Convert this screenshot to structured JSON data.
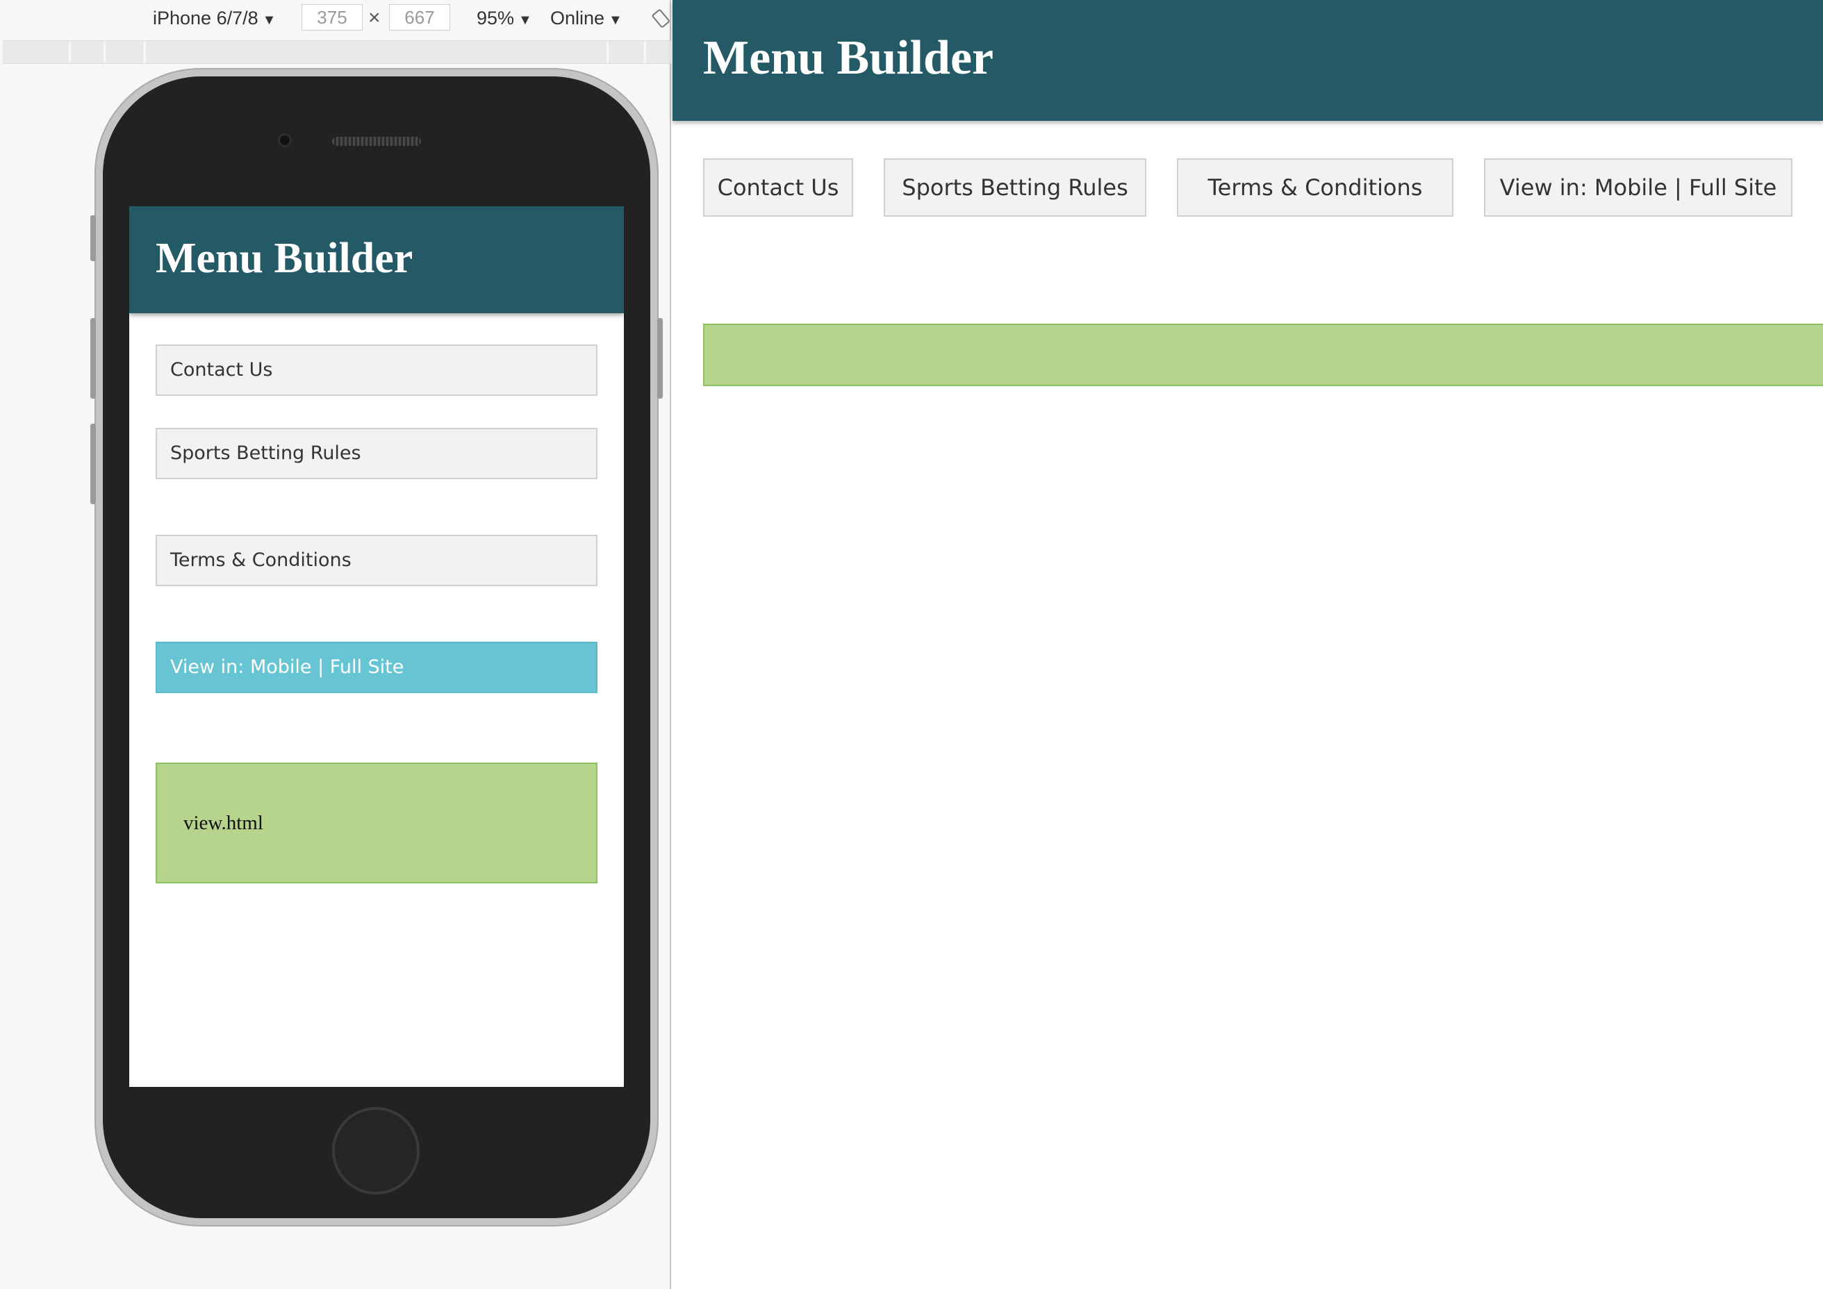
{
  "devtools": {
    "device": "iPhone 6/7/8",
    "width": "375",
    "height": "667",
    "times": "×",
    "zoom": "95%",
    "network": "Online",
    "caret": "▼"
  },
  "mobile": {
    "title": "Menu Builder",
    "menu": [
      {
        "label": "Contact Us",
        "active": false
      },
      {
        "label": "Sports Betting Rules",
        "active": false
      },
      {
        "label": "Terms & Conditions",
        "active": false
      },
      {
        "label": "View in: Mobile | Full Site",
        "active": true
      }
    ],
    "content_label": "view.html"
  },
  "site": {
    "title": "Menu Builder",
    "menu": [
      {
        "label": "Contact Us"
      },
      {
        "label": "Sports Betting Rules"
      },
      {
        "label": "Terms & Conditions"
      },
      {
        "label": "View in: Mobile | Full Site"
      }
    ]
  },
  "colors": {
    "header_bg": "#245a66",
    "button_bg": "#f2f2f2",
    "active_button_bg": "#66c4d3",
    "content_bg": "#b6d48b",
    "content_border": "#8cc063"
  }
}
